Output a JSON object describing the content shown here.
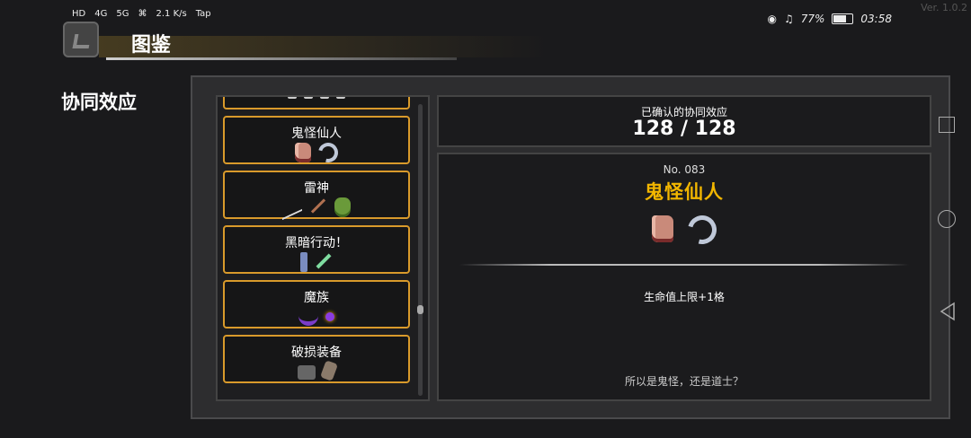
{
  "status_bar": {
    "hd1": "HD",
    "hd2": "HD",
    "signal1": "4G",
    "signal2": "5G",
    "speed": "2.1 K/s",
    "app": "Tap",
    "battery": "77%",
    "battery_level": 0.77,
    "time": "03:58",
    "version": "Ver. 1.0.2"
  },
  "header": {
    "title": "图鉴"
  },
  "page_label": "协同效应",
  "synergy_list": [
    {
      "name": "",
      "icons": [
        "tiny",
        "tiny",
        "tiny",
        "tiny"
      ]
    },
    {
      "name": "鬼怪仙人",
      "icons": [
        "meat",
        "claw"
      ]
    },
    {
      "name": "雷神",
      "icons": [
        "bolt",
        "stick",
        "mask"
      ]
    },
    {
      "name": "黑暗行动！",
      "icons": [
        "vial",
        "syringe"
      ]
    },
    {
      "name": "魔族",
      "icons": [
        "horn",
        "orb"
      ]
    },
    {
      "name": "破损装备",
      "icons": [
        "boot",
        "glove"
      ]
    }
  ],
  "confirmed": {
    "label": "已确认的协同效应",
    "value": "128 / 128"
  },
  "detail": {
    "number": "No. 083",
    "name": "鬼怪仙人",
    "icons": [
      "meat",
      "claw"
    ],
    "effect": "生命值上限+1格",
    "quote": "所以是鬼怪，还是道士？"
  }
}
